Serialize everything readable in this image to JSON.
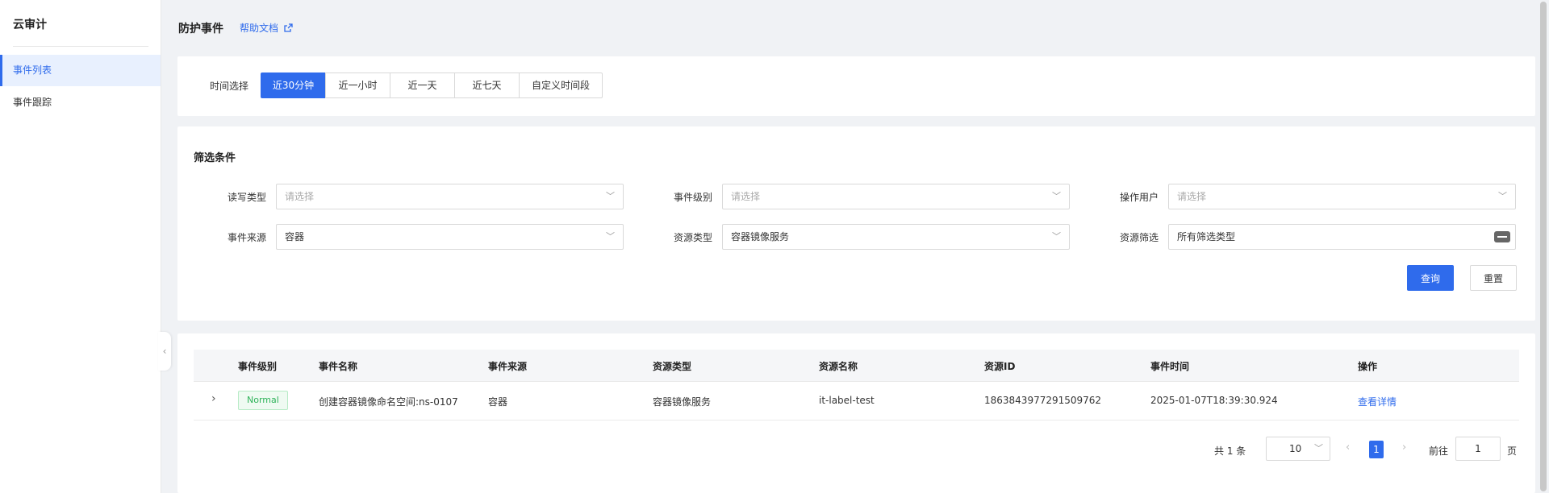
{
  "sidebar": {
    "title": "云审计",
    "items": [
      {
        "label": "事件列表",
        "active": true
      },
      {
        "label": "事件跟踪",
        "active": false
      }
    ]
  },
  "header": {
    "title": "防护事件",
    "help_link": "帮助文档"
  },
  "time_filter": {
    "label": "时间选择",
    "options": [
      "近30分钟",
      "近一小时",
      "近一天",
      "近七天",
      "自定义时间段"
    ],
    "selected": "近30分钟"
  },
  "filters": {
    "title": "筛选条件",
    "read_write_type": {
      "label": "读写类型",
      "placeholder": "请选择",
      "value": ""
    },
    "event_level": {
      "label": "事件级别",
      "placeholder": "请选择",
      "value": ""
    },
    "operator": {
      "label": "操作用户",
      "placeholder": "请选择",
      "value": ""
    },
    "event_source": {
      "label": "事件来源",
      "value": "容器"
    },
    "resource_type": {
      "label": "资源类型",
      "value": "容器镜像服务"
    },
    "resource_filter": {
      "label": "资源筛选",
      "value": "所有筛选类型"
    },
    "query_button": "查询",
    "reset_button": "重置"
  },
  "table": {
    "columns": [
      "事件级别",
      "事件名称",
      "事件来源",
      "资源类型",
      "资源名称",
      "资源ID",
      "事件时间",
      "操作"
    ],
    "rows": [
      {
        "level": "Normal",
        "name": "创建容器镜像命名空间:ns-0107",
        "source": "容器",
        "resource_type": "容器镜像服务",
        "resource_name": "it-label-test",
        "resource_id": "1863843977291509762",
        "time": "2025-01-07T18:39:30.924",
        "action": "查看详情"
      }
    ]
  },
  "pagination": {
    "total_text": "共 1 条",
    "page_size": "10",
    "current_page": "1",
    "goto_label": "前往",
    "goto_value": "1",
    "page_suffix": "页"
  },
  "colors": {
    "primary": "#2f6bec",
    "success": "#2fb35a",
    "background": "#f0f2f5"
  }
}
